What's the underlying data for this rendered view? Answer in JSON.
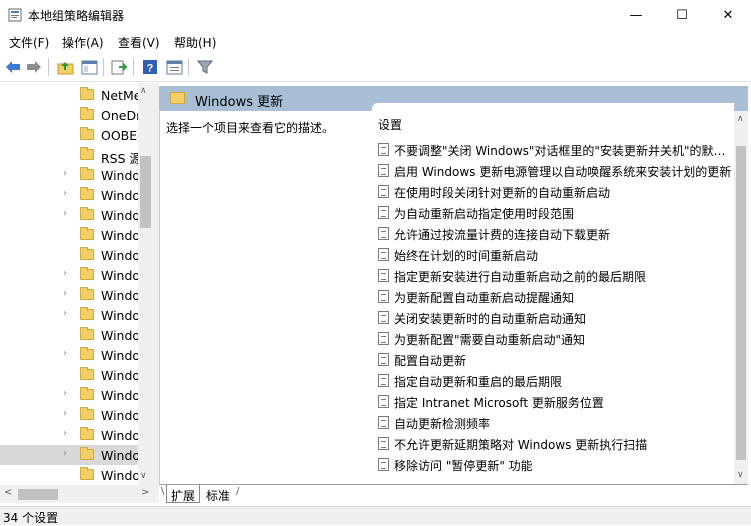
{
  "window": {
    "title": "本地组策略编辑器",
    "controls": [
      "—",
      "☐",
      "✕"
    ]
  },
  "menu": [
    "文件(F)",
    "操作(A)",
    "查看(V)",
    "帮助(H)"
  ],
  "toolbar": [
    "back-arrow-icon",
    "forward-arrow-icon",
    "up-folder-icon",
    "show-hide-tree-icon",
    "export-list-icon",
    "help-icon",
    "properties-icon",
    "filter-icon"
  ],
  "tree": {
    "items": [
      "NetMe",
      "OneDr",
      "OOBE",
      "RSS 源",
      "Windo",
      "Windo",
      "Windo",
      "Windo",
      "Windo",
      "Windo",
      "Windo",
      "Windo",
      "Windo",
      "Windo",
      "Windo",
      "Windo",
      "Windo",
      "Windo",
      "Windo",
      "Windo"
    ],
    "expandable": [
      false,
      false,
      false,
      false,
      true,
      true,
      true,
      false,
      false,
      true,
      true,
      true,
      false,
      true,
      false,
      true,
      true,
      true,
      true,
      false
    ],
    "selected_index": 18
  },
  "right": {
    "header_title": "Windows 更新",
    "description": "选择一个项目来查看它的描述。",
    "column_header": "设置",
    "settings": [
      "不要调整\"关闭 Windows\"对话框里的\"安装更新并关机\"的默认选项",
      "启用 Windows 更新电源管理以自动唤醒系统来安装计划的更新",
      "在使用时段关闭针对更新的自动重新启动",
      "为自动重新启动指定使用时段范围",
      "允许通过按流量计费的连接自动下载更新",
      "始终在计划的时间重新启动",
      "指定更新安装进行自动重新启动之前的最后期限",
      "为更新配置自动重新启动提醒通知",
      "关闭安装更新时的自动重新启动通知",
      "为更新配置\"需要自动重新启动\"通知",
      "配置自动更新",
      "指定自动更新和重启的最后期限",
      "指定 Intranet Microsoft 更新服务位置",
      "自动更新检测频率",
      "不允许更新延期策略对 Windows 更新执行扫描",
      "移除访问 \"暂停更新\" 功能"
    ]
  },
  "tabs": [
    "扩展",
    "标准"
  ],
  "status": "34 个设置"
}
